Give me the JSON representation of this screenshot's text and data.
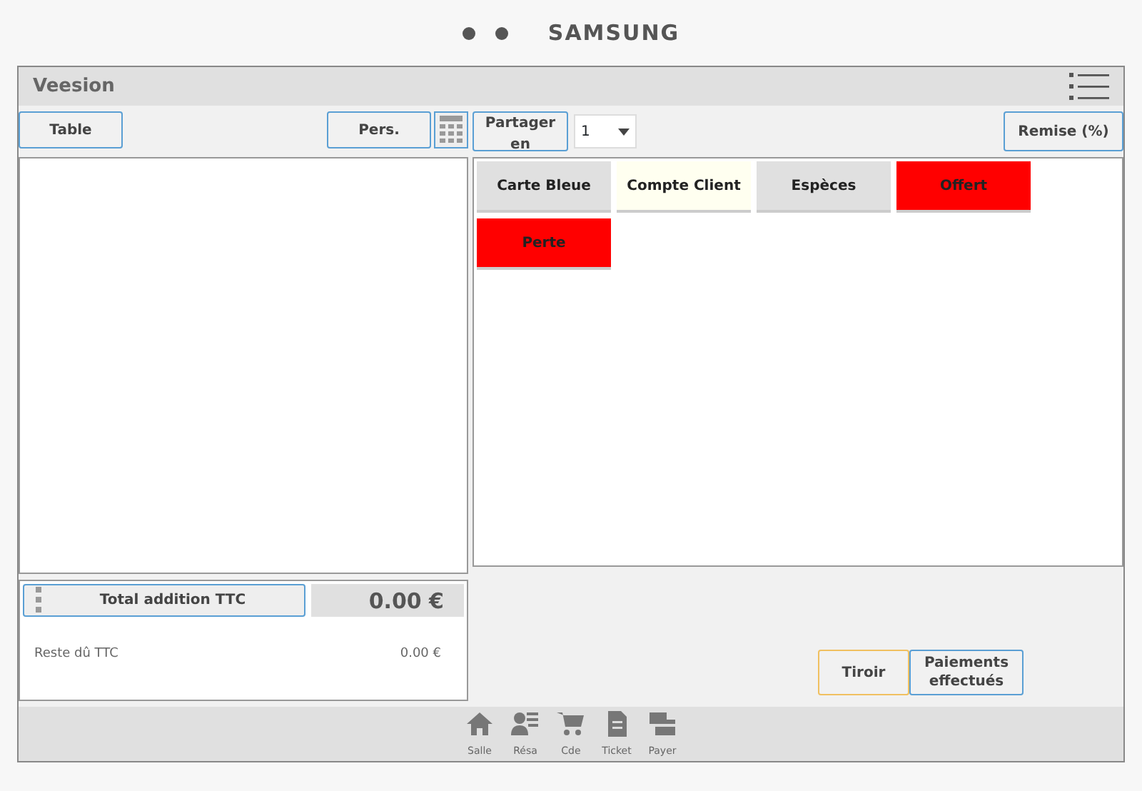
{
  "device": {
    "brand": "SAMSUNG"
  },
  "window": {
    "title": "Veesion"
  },
  "toolbar": {
    "table_button": "Table",
    "persons_button": "Pers.",
    "split_button": "Partager en",
    "split_count": "1",
    "discount_button": "Remise (%)"
  },
  "payment_methods": [
    {
      "label": "Carte Bleue",
      "color": "#e0e0e0"
    },
    {
      "label": "Compte Client",
      "color": "#fffff0"
    },
    {
      "label": "Espèces",
      "color": "#e0e0e0"
    },
    {
      "label": "Offert",
      "color": "#ff0000"
    },
    {
      "label": "Perte",
      "color": "#ff0000"
    }
  ],
  "totals": {
    "total_label": "Total addition TTC",
    "total_value": "0.00 €",
    "remaining_label": "Reste dû TTC",
    "remaining_value": "0.00 €"
  },
  "actions": [
    {
      "label": "Tiroir",
      "kind": "drawer"
    },
    {
      "label": "Paiements effectués",
      "kind": "payments"
    }
  ],
  "nav": [
    {
      "label": "Salle",
      "kind": "home"
    },
    {
      "label": "Résa",
      "kind": "booking"
    },
    {
      "label": "Cde",
      "kind": "cart"
    },
    {
      "label": "Ticket",
      "kind": "ticket"
    },
    {
      "label": "Payer",
      "kind": "pay"
    }
  ]
}
